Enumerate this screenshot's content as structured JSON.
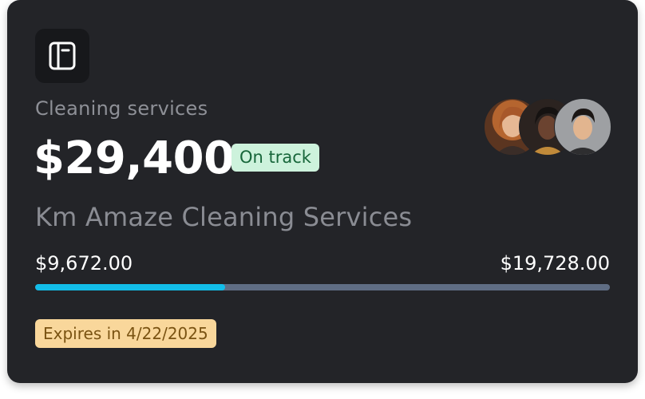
{
  "card": {
    "category": "Cleaning services",
    "amount": "$29,400",
    "status": "On track",
    "company": "Km Amaze Cleaning Services",
    "range_min": "$9,672.00",
    "range_max": "$19,728.00",
    "progress_fraction": 0.33,
    "expires": "Expires in 4/22/2025"
  },
  "icons": {
    "header_icon": "book-icon"
  },
  "avatars": [
    {
      "name": "avatar-1"
    },
    {
      "name": "avatar-2"
    },
    {
      "name": "avatar-3"
    }
  ],
  "colors": {
    "card_bg": "#232428",
    "accent_progress": "#12bde9",
    "progress_track": "#5f6d84",
    "status_bg": "#cdf2dc",
    "status_text": "#17663a",
    "expires_bg": "#f9d79b",
    "expires_text": "#7a5312"
  }
}
